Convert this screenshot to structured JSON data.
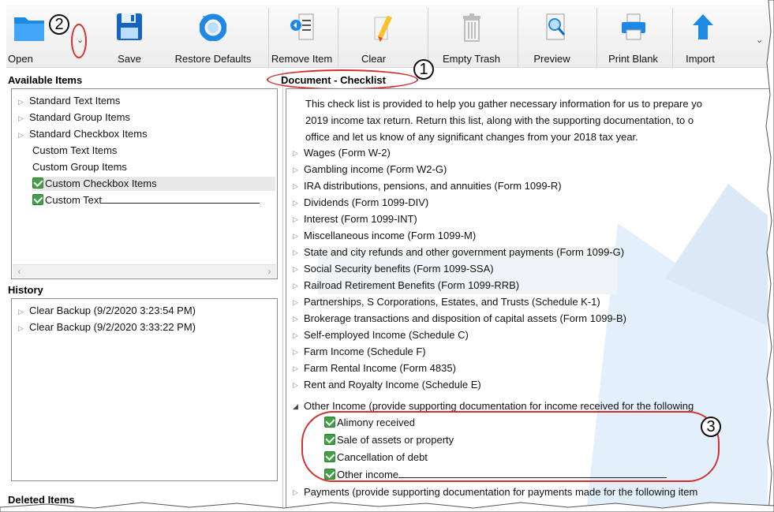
{
  "toolbar": {
    "open": "Open",
    "save": "Save",
    "restore_defaults": "Restore Defaults",
    "remove_item": "Remove Item",
    "clear": "Clear",
    "empty_trash": "Empty Trash",
    "preview": "Preview",
    "print_blank": "Print Blank",
    "import": "Import"
  },
  "annotations": {
    "n1": "1",
    "n2": "2",
    "n3": "3"
  },
  "available": {
    "title": "Available Items",
    "items": [
      "Standard Text Items",
      "Standard Group Items",
      "Standard Checkbox Items",
      "Custom Text Items",
      "Custom Group Items",
      "Custom Checkbox Items",
      "Custom Text"
    ]
  },
  "history": {
    "title": "History",
    "items": [
      "Clear Backup (9/2/2020 3:23:54 PM)",
      "Clear Backup (9/2/2020 3:33:22 PM)"
    ]
  },
  "deleted": {
    "title": "Deleted Items"
  },
  "document": {
    "title": "Document - Checklist",
    "intro": [
      "This check list is provided to help you gather necessary information for us to prepare yo",
      "2019 income tax return.  Return this list, along with the supporting documentation, to o",
      "office and let us know of any significant changes from your 2018 tax year."
    ],
    "items": [
      "Wages (Form W-2)",
      "Gambling income (Form W2-G)",
      "IRA distributions, pensions, and annuities (Form 1099-R)",
      "Dividends (Form 1099-DIV)",
      "Interest (Form 1099-INT)",
      "Miscellaneous income (Form 1099-M)",
      "State and city refunds and other government payments (Form 1099-G)",
      "Social Security benefits (Form 1099-SSA)",
      "Railroad Retirement Benefits (Form 1099-RRB)",
      "Partnerships, S Corporations, Estates, and Trusts (Schedule K-1)",
      "Brokerage transactions and disposition of capital assets (Form 1099-B)",
      "Self-employed Income (Schedule C)",
      "Farm Income (Schedule F)",
      "Farm Rental Income (Form 4835)",
      "Rent and Royalty Income (Schedule E)"
    ],
    "other_income": "Other Income (provide supporting documentation for income received for the following",
    "other_sub": [
      "Alimony received",
      "Sale of assets or property",
      "Cancellation of debt",
      "Other income"
    ],
    "payments": "Payments (provide supporting documentation for payments made for the following item"
  }
}
